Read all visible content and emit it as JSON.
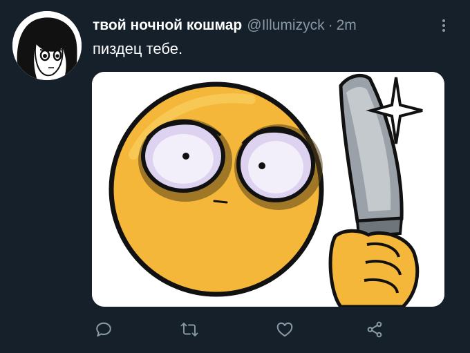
{
  "tweet": {
    "author_name": "твой ночной кошмар",
    "author_handle": "@Illumizyck",
    "separator": "·",
    "timestamp": "2m",
    "text": "пиздец тебе."
  },
  "icons": {
    "more": "more-vertical-icon",
    "reply": "reply-bubble-icon",
    "retweet": "retweet-icon",
    "like": "heart-icon",
    "share": "share-icon"
  },
  "colors": {
    "background": "#15202b",
    "secondary_text": "#8899a6",
    "primary_text": "#ffffff"
  }
}
